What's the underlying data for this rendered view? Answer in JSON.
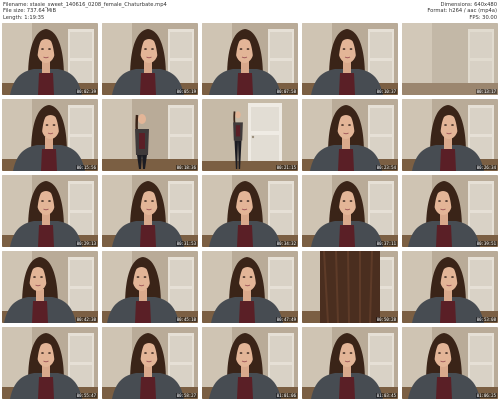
{
  "header": {
    "filename_line": "Filename: stasie_sweet_140616_0208_female_Chaturbate.mp4",
    "filesize_line": "File size: 737.64 MiB",
    "length_line": "Length: 1:19:35",
    "dimensions_line": "Dimensions: 640x480",
    "format_line": "Format: h264 / aac (mp4a)",
    "fps_line": "FPS: 30.00"
  },
  "frames": [
    {
      "scene": "face",
      "time": "00:02:39"
    },
    {
      "scene": "face",
      "time": "00:05:19"
    },
    {
      "scene": "face",
      "time": "00:07:58"
    },
    {
      "scene": "face",
      "time": "00:10:37"
    },
    {
      "scene": "empty",
      "time": "00:13:17"
    },
    {
      "scene": "face",
      "time": "00:15:56"
    },
    {
      "scene": "stand",
      "time": "00:18:36"
    },
    {
      "scene": "door",
      "time": "00:21:15"
    },
    {
      "scene": "face",
      "time": "00:23:54"
    },
    {
      "scene": "face",
      "time": "00:26:34"
    },
    {
      "scene": "face",
      "time": "00:29:13"
    },
    {
      "scene": "face",
      "time": "00:31:53"
    },
    {
      "scene": "face",
      "time": "00:34:32"
    },
    {
      "scene": "face",
      "time": "00:37:11"
    },
    {
      "scene": "face",
      "time": "00:39:51"
    },
    {
      "scene": "lean",
      "time": "00:42:30"
    },
    {
      "scene": "face",
      "time": "00:45:10"
    },
    {
      "scene": "face",
      "time": "00:47:49"
    },
    {
      "scene": "hair",
      "time": "00:50:28"
    },
    {
      "scene": "face",
      "time": "00:53:08"
    },
    {
      "scene": "face",
      "time": "00:55:47"
    },
    {
      "scene": "face",
      "time": "00:58:27"
    },
    {
      "scene": "face",
      "time": "01:01:06"
    },
    {
      "scene": "face",
      "time": "01:03:45"
    },
    {
      "scene": "face",
      "time": "01:06:25"
    }
  ]
}
